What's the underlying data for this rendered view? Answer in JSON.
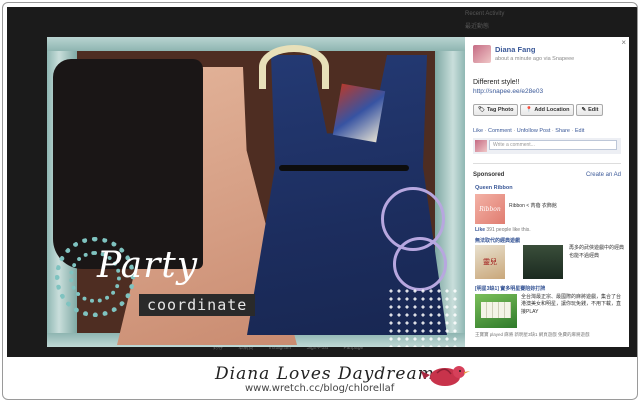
{
  "background": {
    "sponsored_header_text": "Recent Activity",
    "sponsored_header_text2": "最近動態",
    "bottom_links": [
      "封存",
      "本網頁",
      "Instagram",
      "Sign-Post",
      "Fanpage"
    ]
  },
  "photo": {
    "title_script": "Party",
    "subtitle": "coordinate",
    "accent_colors": {
      "teal": "#7fc3c0",
      "lilac": "#b7a7df",
      "navy": "#1c2d5e",
      "blush": "#d49c82"
    }
  },
  "post": {
    "poster_name": "Diana Fang",
    "meta": "about a minute ago via Snapeee",
    "status_text": "Different style!!",
    "link": "http://snapee.ee/e28e03",
    "buttons": {
      "tag": "Tag Photo",
      "location": "Add Location",
      "edit": "Edit"
    },
    "actions": [
      "Like",
      "Comment",
      "Unfollow Post",
      "Share",
      "Edit"
    ],
    "comment_placeholder": "Write a comment...",
    "close_symbol": "×"
  },
  "sponsored": {
    "title": "Sponsored",
    "create_ad": "Create an Ad",
    "ad1": {
      "name": "Queen Ribbon",
      "image_text": "Ribbon",
      "text": "Ribbon < 芮蓓 衣飾館",
      "like_label": "Like",
      "like_count": "391 people like this."
    },
    "ad2": {
      "title": "無法取代的經典遊戲",
      "image_text": "靈兒",
      "left_text": "再多的武俠遊戲中的經典",
      "right_text": "也能不過經典"
    },
    "ad3": {
      "title": "[明星3缺1] 實多明星賽陪妳打牌",
      "text": "全台灣最正宗、最國際的麻將遊戲，集合了台港澳美女和明星，讓你玩免錢，不用下載，直接PLAY",
      "footer": "王寶寶 played 麻將 新明星3缺1 網頁遊戲 免費的麻將遊戲"
    }
  },
  "banner": {
    "title": "Diana Loves Daydream",
    "url": "www.wretch.cc/blog/chlorellaf"
  }
}
